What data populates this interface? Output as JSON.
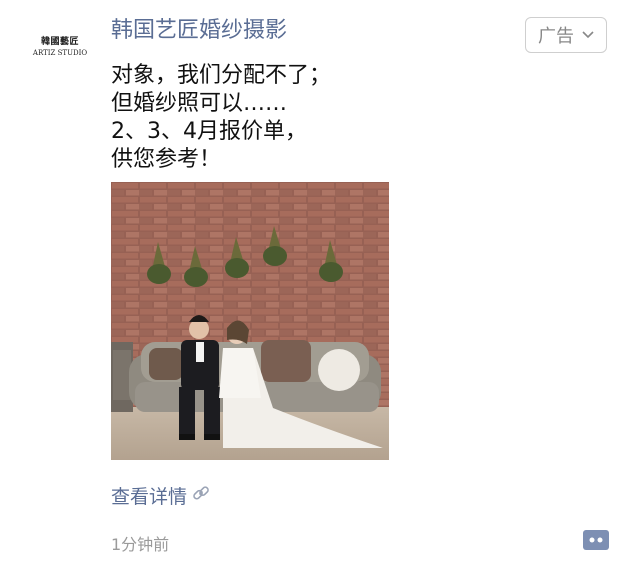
{
  "account": {
    "logo_text_cn": "韓國藝匠",
    "logo_text_en": "ARTIZ STUDIO",
    "name": "韩国艺匠婚纱摄影"
  },
  "ad_tag": {
    "label": "广告",
    "icon": "chevron-down-icon"
  },
  "post": {
    "lines": [
      "对象，我们分配不了；",
      "但婚纱照可以……",
      "2、3、4月报价单，",
      "供您参考！"
    ]
  },
  "image": {
    "description_icon": "wedding-photo"
  },
  "link": {
    "label": "查看详情",
    "icon": "link-icon"
  },
  "meta": {
    "time": "1分钟前",
    "comment_icon": "comment-dots-icon"
  },
  "colors": {
    "link_blue": "#5a6d94",
    "time_gray": "#9a9a9a"
  }
}
